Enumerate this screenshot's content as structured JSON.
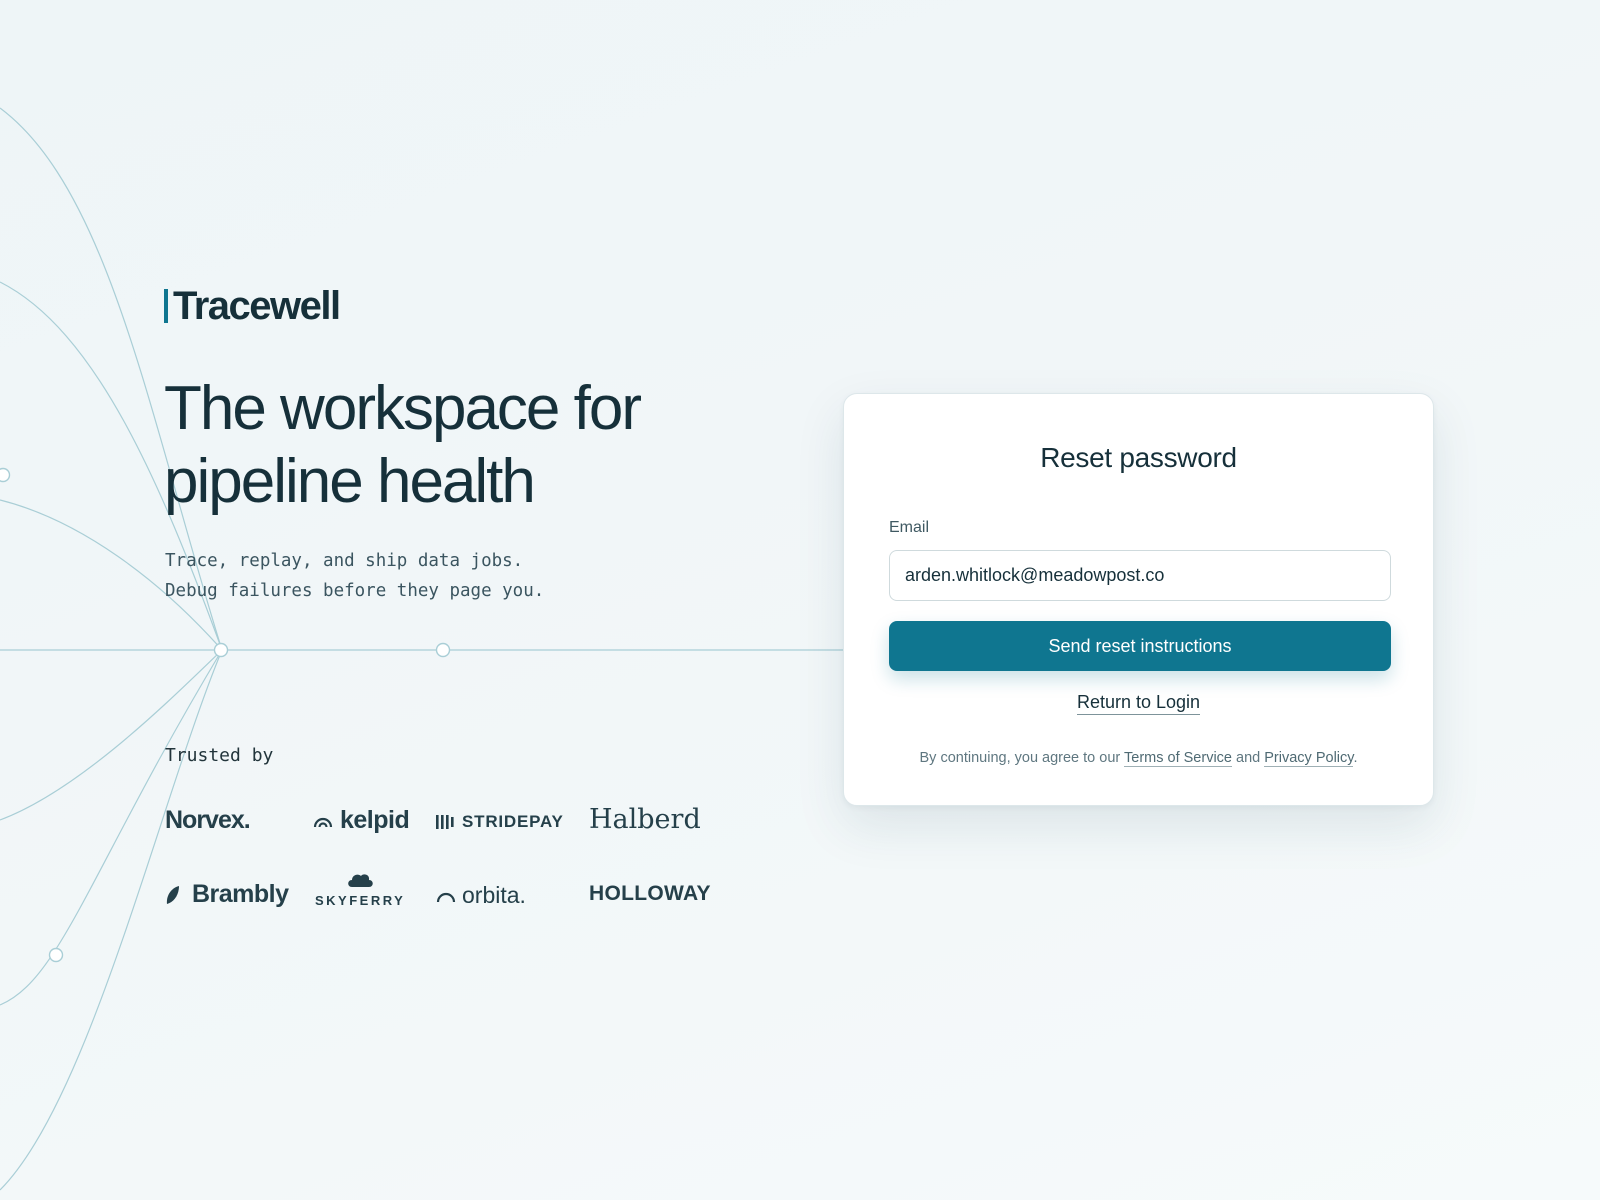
{
  "brand": {
    "name": "Tracewell",
    "accent_color": "#0f7690"
  },
  "hero": {
    "headline_line1": "The workspace for",
    "headline_line2": "pipeline health",
    "tagline_line1": "Trace, replay, and ship data jobs.",
    "tagline_line2": "Debug failures before they page you."
  },
  "trusted": {
    "label": "Trusted by",
    "logos": [
      {
        "name": "Norvex.",
        "icon": ""
      },
      {
        "name": "kelpid",
        "icon": "arc-icon"
      },
      {
        "name": "STRIDEPAY",
        "icon": "bars-icon"
      },
      {
        "name": "Halberd",
        "icon": ""
      },
      {
        "name": "Brambly",
        "icon": "leaf-icon"
      },
      {
        "name": "SKYFERRY",
        "icon": "cloud-icon"
      },
      {
        "name": "orbita.",
        "icon": "orbit-arc-icon"
      },
      {
        "name": "HOLLOWAY",
        "icon": ""
      }
    ]
  },
  "reset_form": {
    "title": "Reset password",
    "email_label": "Email",
    "email_value": "arden.whitlock@meadowpost.co",
    "submit_label": "Send reset instructions",
    "return_link": "Return to Login",
    "legal_prefix": "By continuing, you agree to our",
    "terms_link": "Terms of Service",
    "legal_and": "and",
    "privacy_link": "Privacy Policy",
    "legal_suffix": ".",
    "button_color": "#0f7690"
  }
}
